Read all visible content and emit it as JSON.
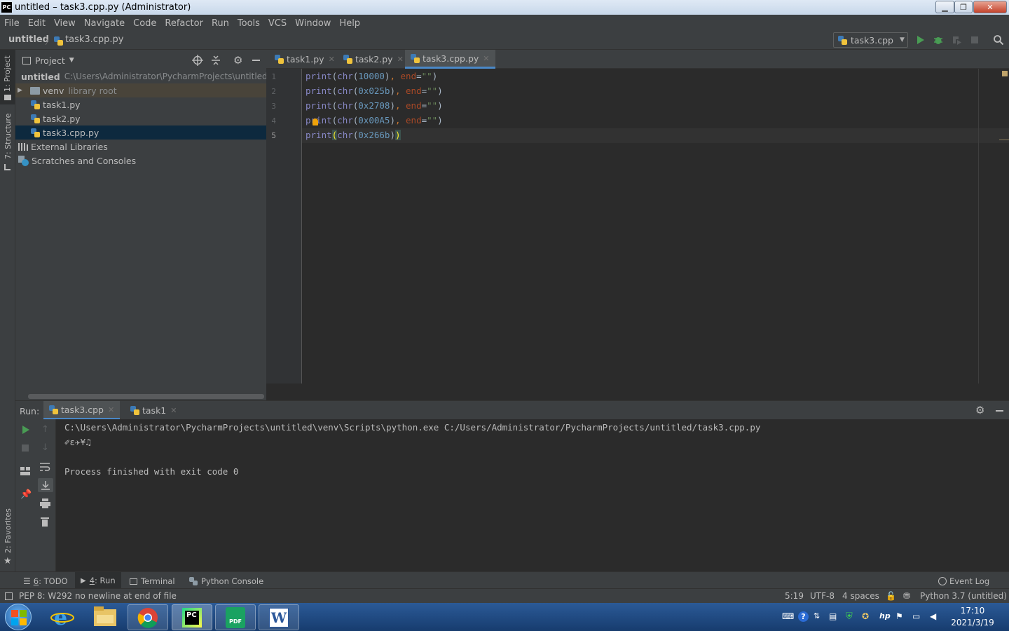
{
  "window": {
    "title": "untitled – task3.cpp.py (Administrator)",
    "app_icon_text": "PC"
  },
  "menu": {
    "items": [
      "File",
      "Edit",
      "View",
      "Navigate",
      "Code",
      "Refactor",
      "Run",
      "Tools",
      "VCS",
      "Window",
      "Help"
    ]
  },
  "breadcrumb": {
    "project": "untitled",
    "file": "task3.cpp.py"
  },
  "run_config": {
    "selected": "task3.cpp"
  },
  "left_strip": {
    "project_label": "1: Project",
    "structure_label": "7: Structure",
    "favorites_label": "2: Favorites"
  },
  "project_panel": {
    "title": "Project",
    "root_name": "untitled",
    "root_path": "C:\\Users\\Administrator\\PycharmProjects\\untitled",
    "venv_name": "venv",
    "venv_note": "library root",
    "files": [
      "task1.py",
      "task2.py",
      "task3.cpp.py"
    ],
    "external_libraries": "External Libraries",
    "scratches": "Scratches and Consoles"
  },
  "editor": {
    "tabs": [
      "task1.py",
      "task2.py",
      "task3.cpp.py"
    ],
    "active_tab": "task3.cpp.py",
    "line_numbers": [
      "1",
      "2",
      "3",
      "4",
      "5"
    ],
    "lines": [
      {
        "fn": "print",
        "open": "(",
        "inner_fn": "chr",
        "p1": "(",
        "arg": "10000",
        "p2": ")",
        "comma": ", ",
        "kw": "end",
        "eq": "=",
        "str": "\"\"",
        "close": ")"
      },
      {
        "fn": "print",
        "open": "(",
        "inner_fn": "chr",
        "p1": "(",
        "arg": "0x025b",
        "p2": ")",
        "comma": ", ",
        "kw": "end",
        "eq": "=",
        "str": "\"\"",
        "close": ")"
      },
      {
        "fn": "print",
        "open": "(",
        "inner_fn": "chr",
        "p1": "(",
        "arg": "0x2708",
        "p2": ")",
        "comma": ", ",
        "kw": "end",
        "eq": "=",
        "str": "\"\"",
        "close": ")"
      },
      {
        "fn": "print",
        "open": "(",
        "inner_fn": "chr",
        "p1": "(",
        "arg": "0x00A5",
        "p2": ")",
        "comma": ", ",
        "kw": "end",
        "eq": "=",
        "str": "\"\"",
        "close": ")"
      },
      {
        "fn": "print",
        "open": "(",
        "inner_fn": "chr",
        "p1": "(",
        "arg": "0x266b",
        "p2": ")",
        "close": ")"
      }
    ]
  },
  "run_panel": {
    "label": "Run:",
    "tabs": [
      "task3.cpp",
      "task1"
    ],
    "command": "C:\\Users\\Administrator\\PycharmProjects\\untitled\\venv\\Scripts\\python.exe C:/Users/Administrator/PycharmProjects/untitled/task3.cpp.py",
    "output": "✐ɛ✈¥♫",
    "exit_message": "Process finished with exit code 0"
  },
  "bottom_tabs": {
    "todo_num": "6",
    "todo": ": TODO",
    "run_num": "4",
    "run": ": Run",
    "terminal": "Terminal",
    "python_console": "Python Console",
    "event_log": "Event Log"
  },
  "status": {
    "message": "PEP 8: W292 no newline at end of file",
    "position": "5:19",
    "encoding": "UTF-8",
    "indent": "4 spaces",
    "interpreter": "Python 3.7 (untitled)"
  },
  "taskbar": {
    "time": "17:10",
    "date": "2021/3/19",
    "pdf_label": "PDF"
  },
  "colors": {
    "editor_bg": "#2b2b2b",
    "panel_bg": "#3c3f41",
    "selection": "#0d293e",
    "function": "#8888c6",
    "number": "#6897bb",
    "keyword_arg": "#aa4926",
    "string": "#6a8759",
    "comma": "#cc7832"
  }
}
